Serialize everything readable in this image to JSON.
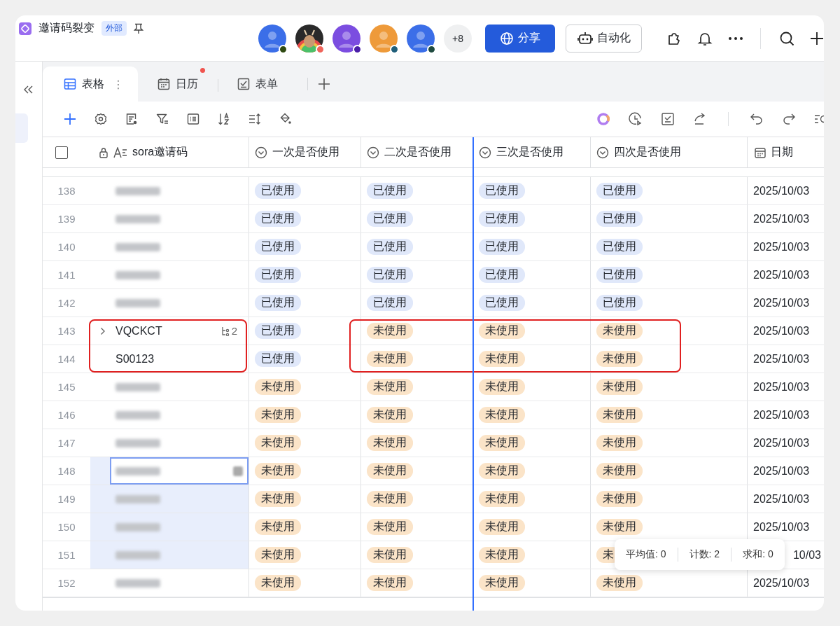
{
  "app": {
    "title": "邀请码裂变",
    "badge": "外部"
  },
  "collaborators": [
    {
      "kind": "person",
      "color": "#2f4a12"
    },
    {
      "kind": "picture",
      "color": "#f0645a"
    },
    {
      "kind": "person",
      "color": "#4a1fa8"
    },
    {
      "kind": "person",
      "color": "#1f5f7a"
    },
    {
      "kind": "person",
      "color": "#1f4a3f"
    }
  ],
  "more_collaborators": "+8",
  "share_button": "分享",
  "automation_button": "自动化",
  "tabs": [
    {
      "label": "表格",
      "menu": "⋮",
      "selected": true,
      "badge_dot": false
    },
    {
      "label": "日历",
      "selected": false,
      "badge_dot": true
    },
    {
      "label": "表单",
      "selected": false,
      "badge_dot": false
    }
  ],
  "select_all": {
    "checked": false
  },
  "columns": [
    {
      "label": "sora邀请码"
    },
    {
      "label": "一次是否使用"
    },
    {
      "label": "二次是否使用"
    },
    {
      "label": "三次是否使用"
    },
    {
      "label": "四次是否使用"
    },
    {
      "label": "日期"
    }
  ],
  "rows": [
    {
      "num": "138",
      "code_blurred": true,
      "status": [
        {
          "kind": "used",
          "text": "已使用"
        },
        {
          "kind": "used",
          "text": "已使用"
        },
        {
          "kind": "used",
          "text": "已使用"
        },
        {
          "kind": "used",
          "text": "已使用"
        }
      ],
      "date": "2025/10/03"
    },
    {
      "num": "139",
      "code_blurred": true,
      "status": [
        {
          "kind": "used",
          "text": "已使用"
        },
        {
          "kind": "used",
          "text": "已使用"
        },
        {
          "kind": "used",
          "text": "已使用"
        },
        {
          "kind": "used",
          "text": "已使用"
        }
      ],
      "date": "2025/10/03"
    },
    {
      "num": "140",
      "code_blurred": true,
      "status": [
        {
          "kind": "used",
          "text": "已使用"
        },
        {
          "kind": "used",
          "text": "已使用"
        },
        {
          "kind": "used",
          "text": "已使用"
        },
        {
          "kind": "used",
          "text": "已使用"
        }
      ],
      "date": "2025/10/03"
    },
    {
      "num": "141",
      "code_blurred": true,
      "status": [
        {
          "kind": "used",
          "text": "已使用"
        },
        {
          "kind": "used",
          "text": "已使用"
        },
        {
          "kind": "used",
          "text": "已使用"
        },
        {
          "kind": "used",
          "text": "已使用"
        }
      ],
      "date": "2025/10/03"
    },
    {
      "num": "142",
      "code_blurred": true,
      "status": [
        {
          "kind": "used",
          "text": "已使用"
        },
        {
          "kind": "used",
          "text": "已使用"
        },
        {
          "kind": "used",
          "text": "已使用"
        },
        {
          "kind": "used",
          "text": "已使用"
        }
      ],
      "date": "2025/10/03"
    },
    {
      "num": "143",
      "code": "VQCKCT",
      "expandable": true,
      "subrecords": "2",
      "circled": true,
      "status": [
        {
          "kind": "used",
          "text": "已使用"
        },
        {
          "kind": "unused",
          "text": "未使用"
        },
        {
          "kind": "unused",
          "text": "未使用"
        },
        {
          "kind": "unused",
          "text": "未使用"
        }
      ],
      "date": "2025/10/03"
    },
    {
      "num": "144",
      "code": "S00123",
      "circled": true,
      "status": [
        {
          "kind": "used",
          "text": "已使用"
        },
        {
          "kind": "unused",
          "text": "未使用"
        },
        {
          "kind": "unused",
          "text": "未使用"
        },
        {
          "kind": "unused",
          "text": "未使用"
        }
      ],
      "date": "2025/10/03"
    },
    {
      "num": "145",
      "code_blurred": true,
      "status": [
        {
          "kind": "unused",
          "text": "未使用"
        },
        {
          "kind": "unused",
          "text": "未使用"
        },
        {
          "kind": "unused",
          "text": "未使用"
        },
        {
          "kind": "unused",
          "text": "未使用"
        }
      ],
      "date": "2025/10/03"
    },
    {
      "num": "146",
      "code_blurred": true,
      "status": [
        {
          "kind": "unused",
          "text": "未使用"
        },
        {
          "kind": "unused",
          "text": "未使用"
        },
        {
          "kind": "unused",
          "text": "未使用"
        },
        {
          "kind": "unused",
          "text": "未使用"
        }
      ],
      "date": "2025/10/03"
    },
    {
      "num": "147",
      "code_blurred": true,
      "status": [
        {
          "kind": "unused",
          "text": "未使用"
        },
        {
          "kind": "unused",
          "text": "未使用"
        },
        {
          "kind": "unused",
          "text": "未使用"
        },
        {
          "kind": "unused",
          "text": "未使用"
        }
      ],
      "date": "2025/10/03"
    },
    {
      "num": "148",
      "code_blurred": true,
      "selected": true,
      "active": true,
      "status": [
        {
          "kind": "unused",
          "text": "未使用"
        },
        {
          "kind": "unused",
          "text": "未使用"
        },
        {
          "kind": "unused",
          "text": "未使用"
        },
        {
          "kind": "unused",
          "text": "未使用"
        }
      ],
      "date": "2025/10/03"
    },
    {
      "num": "149",
      "code_blurred": true,
      "selected": true,
      "status": [
        {
          "kind": "unused",
          "text": "未使用"
        },
        {
          "kind": "unused",
          "text": "未使用"
        },
        {
          "kind": "unused",
          "text": "未使用"
        },
        {
          "kind": "unused",
          "text": "未使用"
        }
      ],
      "date": "2025/10/03"
    },
    {
      "num": "150",
      "code_blurred": true,
      "selected": true,
      "status": [
        {
          "kind": "unused",
          "text": "未使用"
        },
        {
          "kind": "unused",
          "text": "未使用"
        },
        {
          "kind": "unused",
          "text": "未使用"
        },
        {
          "kind": "unused",
          "text": "未使用"
        }
      ],
      "date": "2025/10/03"
    },
    {
      "num": "151",
      "code_blurred": true,
      "selected": true,
      "covered": true,
      "status": [
        {
          "kind": "unused",
          "text": "未使用"
        },
        {
          "kind": "unused",
          "text": "未使用"
        },
        {
          "kind": "unused",
          "text": "未使用"
        },
        {
          "kind": "unused",
          "text": "未"
        }
      ],
      "date": "10/03"
    },
    {
      "num": "152",
      "code_blurred": true,
      "status": [
        {
          "kind": "unused",
          "text": "未使用"
        },
        {
          "kind": "unused",
          "text": "未使用"
        },
        {
          "kind": "unused",
          "text": "未使用"
        },
        {
          "kind": "unused",
          "text": "未使用"
        }
      ],
      "date": "2025/10/03"
    }
  ],
  "summary": [
    {
      "label": "平均值: 0"
    },
    {
      "label": "计数: 2"
    },
    {
      "label": "求和: 0"
    }
  ]
}
